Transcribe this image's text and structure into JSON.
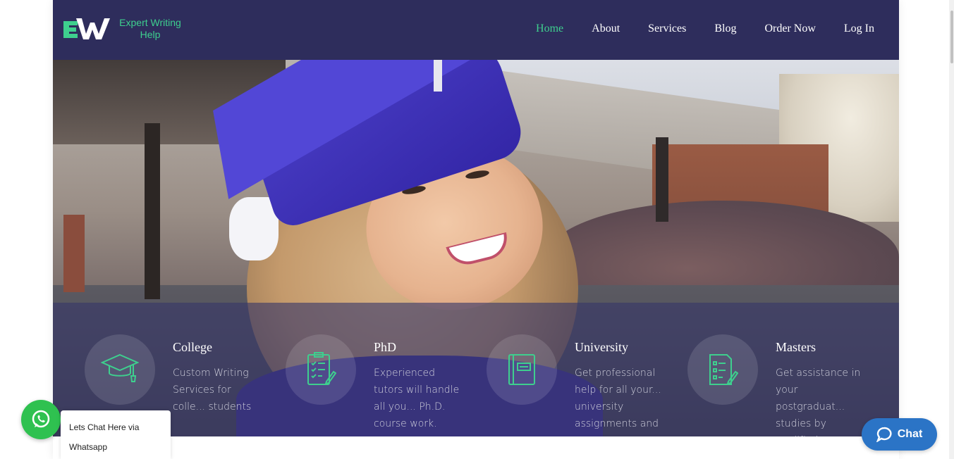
{
  "header": {
    "logo_text": "Expert Writing\nHelp",
    "logo_icon": "ew-logo-icon",
    "nav": [
      {
        "label": "Home",
        "active": true
      },
      {
        "label": "About",
        "active": false
      },
      {
        "label": "Services",
        "active": false
      },
      {
        "label": "Blog",
        "active": false
      },
      {
        "label": "Order Now",
        "active": false
      },
      {
        "label": "Log In",
        "active": false
      }
    ]
  },
  "features": [
    {
      "title": "College",
      "desc": "Custom Writing Services for colle... students",
      "icon": "graduation-cap-icon"
    },
    {
      "title": "PhD",
      "desc": "Experienced tutors will handle all you... Ph.D. course work.",
      "icon": "checklist-icon"
    },
    {
      "title": "University",
      "desc": "Get professional help for all your... university assignments and",
      "icon": "book-icon"
    },
    {
      "title": "Masters",
      "desc": "Get assistance in your postgraduat... studies by qualified experts.",
      "icon": "checklist-pen-icon"
    }
  ],
  "whatsapp": {
    "text": "Lets Chat Here via Whatsapp"
  },
  "chat": {
    "label": "Chat"
  },
  "colors": {
    "header_bg": "#2e2d5c",
    "accent_green": "#3ecf8e",
    "whatsapp_green": "#2fc150",
    "chat_blue": "#2b74c6"
  }
}
